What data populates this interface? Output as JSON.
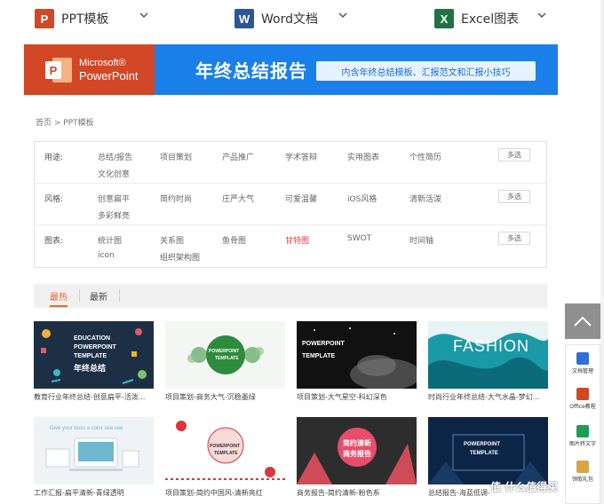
{
  "nav": {
    "items": [
      {
        "label": "PPT模板",
        "icon": "ppt-app-icon",
        "letter": "P",
        "color": "#d24726"
      },
      {
        "label": "Word文档",
        "icon": "word-app-icon",
        "letter": "W",
        "color": "#2b579a"
      },
      {
        "label": "Excel图表",
        "icon": "excel-app-icon",
        "letter": "X",
        "color": "#217346"
      }
    ]
  },
  "banner": {
    "ms": "Microsoft®",
    "product": "PowerPoint",
    "title": "年终总结报告",
    "pill": "内含年终总结模板、汇报范文和汇报小技巧"
  },
  "breadcrumb": "首页 > PPT模板",
  "filters": {
    "multi_label": "多选",
    "rows": [
      {
        "label": "用途:",
        "options": [
          "总结/报告",
          "项目策划",
          "产品推广",
          "学术答辩",
          "实用图表",
          "个性简历",
          "文化创意"
        ]
      },
      {
        "label": "风格:",
        "options": [
          "创意扁平",
          "简约时尚",
          "庄严大气",
          "可爱温馨",
          "iOS风格",
          "清新活泼",
          "多彩鲜亮"
        ]
      },
      {
        "label": "图表:",
        "options": [
          "统计图",
          "关系图",
          "鱼骨图",
          "甘特图",
          "SWOT",
          "时间轴",
          "icon",
          "组织架构图"
        ],
        "active_index": 3
      }
    ]
  },
  "tabs": {
    "hot": "最热",
    "new": "最新"
  },
  "cards": [
    {
      "caption": "教育行业年终总结-创意扁平-活泼...",
      "text1": "EDUCATION",
      "text2": "POWERPOINT",
      "text3": "TEMPLATE",
      "text4": "年终总结"
    },
    {
      "caption": "项目策划-商务大气-沉稳墨绿",
      "text1": "POWERPOINT",
      "text2": "TEMPLATE"
    },
    {
      "caption": "项目策划-大气星空-科幻深色",
      "text1": "POWERPOINT",
      "text2": "TEMPLATE"
    },
    {
      "caption": "时尚行业年终总结-大气水晶-梦幻...",
      "text1": "FASHION"
    },
    {
      "caption": "工作汇报-扁平清新-青绿透明",
      "text1": "Give your boss a color see see"
    },
    {
      "caption": "项目策划-简约中国风-清新亮红",
      "text1": "POWERPOINT",
      "text2": "TEMPLATE"
    },
    {
      "caption": "商务报告-简约清新-粉色系",
      "text1": "简约清新",
      "text2": "商务报告"
    },
    {
      "caption": "总结报告-海蓝低调-",
      "text1": "POWERPOINT",
      "text2": "TEMPLATE"
    }
  ],
  "side": {
    "items": [
      {
        "label": "文档管理",
        "icon": "document-manage-icon",
        "color": "#2f6fd6"
      },
      {
        "label": "Office教程",
        "icon": "office-tutorial-icon",
        "color": "#d24726"
      },
      {
        "label": "图片转文字",
        "icon": "image-to-text-icon",
        "color": "#1f9d55"
      },
      {
        "label": "领取礼包",
        "icon": "gift-icon",
        "color": "#d9a441"
      }
    ]
  },
  "watermark": "值 什么值得买"
}
